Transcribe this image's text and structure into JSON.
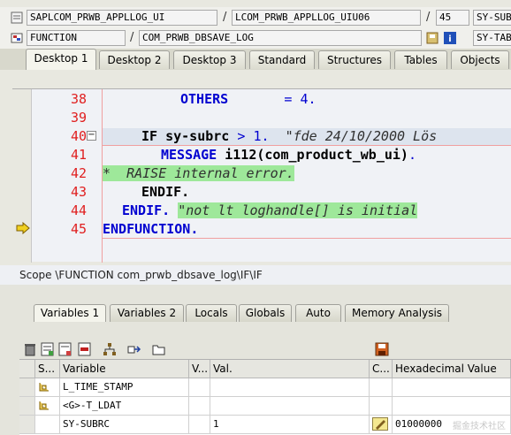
{
  "header": {
    "row1": {
      "program": "SAPLCOM_PRWB_APPLLOG_UI",
      "include": "LCOM_PRWB_APPLLOG_UIU06",
      "line": "45",
      "field": "SY-SUBRC"
    },
    "row2": {
      "event_type": "FUNCTION",
      "event_name": "COM_PRWB_DBSAVE_LOG",
      "field2": "SY-TABIX"
    }
  },
  "desktop_tabs": [
    "Desktop 1",
    "Desktop 2",
    "Desktop 3",
    "Standard",
    "Structures",
    "Tables",
    "Objects"
  ],
  "code": {
    "line_numbers": [
      "38",
      "39",
      "40",
      "41",
      "42",
      "43",
      "44",
      "45"
    ],
    "l38_kw": "OTHERS",
    "l38_eq": "=",
    "l38_val": "4",
    "l38_dot": ".",
    "l40_if": "IF",
    "l40_var": "sy-subrc",
    "l40_op": ">",
    "l40_num": "1",
    "l40_dot": ".",
    "l40_comment": "\"fde 24/10/2000 Lös",
    "l41_kw": "MESSAGE",
    "l41_rest": "i112(com_product_wb_ui)",
    "l41_dot": ".",
    "l42_comment": "*  RAISE internal error.",
    "l43_kw": "ENDIF.",
    "l44_kw": "ENDIF.",
    "l44_comment": "\"not lt loghandle[] is initial",
    "l45_kw": "ENDFUNCTION."
  },
  "scope": "Scope \\FUNCTION com_prwb_dbsave_log\\IF\\IF",
  "var_tabs": [
    "Variables 1",
    "Variables 2",
    "Locals",
    "Globals",
    "Auto",
    "Memory Analysis"
  ],
  "grid": {
    "headers": [
      "S...",
      "Variable",
      "V...",
      "Val.",
      "C...",
      "Hexadecimal Value"
    ],
    "rows": [
      {
        "variable": "L_TIME_STAMP",
        "value": "",
        "hex": ""
      },
      {
        "variable": "<G>-T_LDAT",
        "value": "",
        "hex": ""
      },
      {
        "variable": "SY-SUBRC",
        "value": "1",
        "hex": "01000000"
      }
    ]
  },
  "watermark": "掘金技术社区",
  "colors": {
    "keyword": "#0000d0",
    "line_number": "#e02020",
    "comment_highlight": "#9ee89a"
  }
}
